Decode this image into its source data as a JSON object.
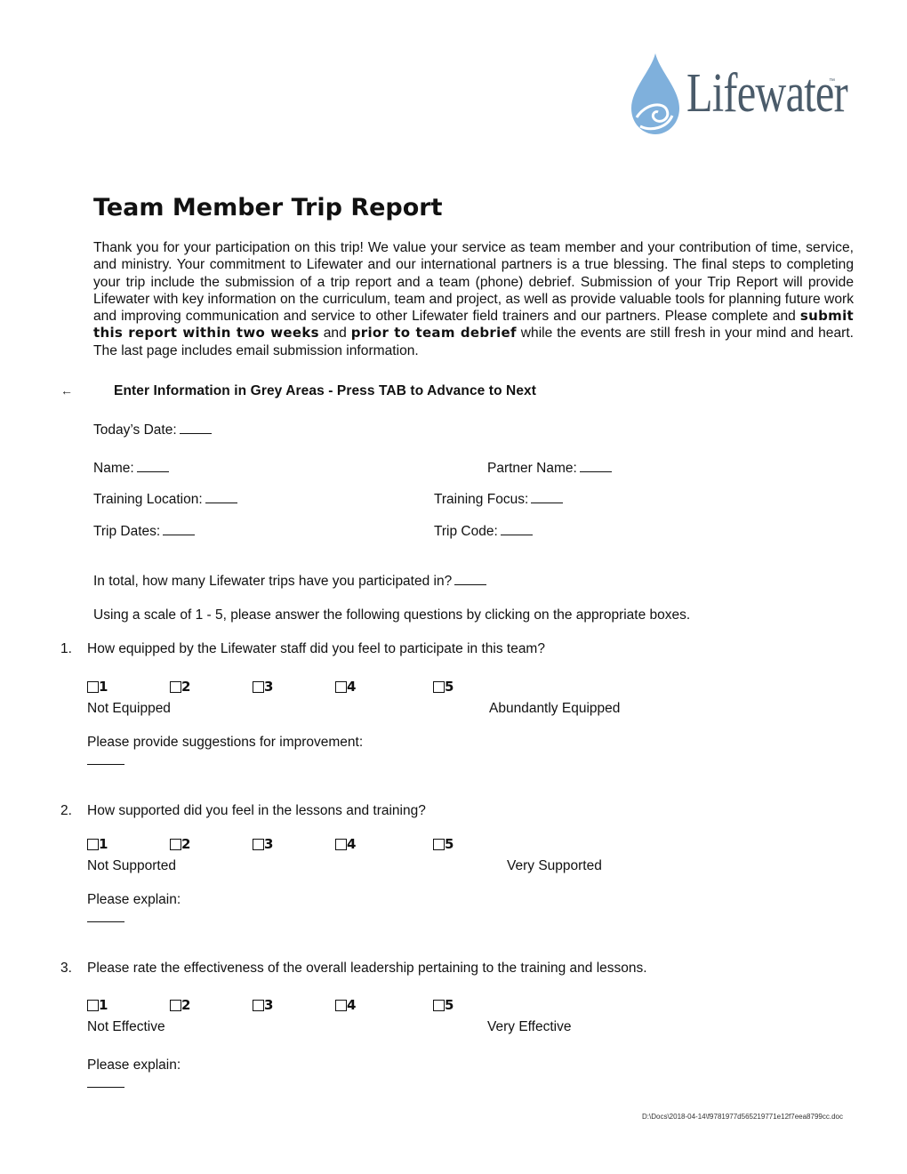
{
  "logo": {
    "brand": "Lifewater",
    "trademark": "™",
    "icon": "water-drop-icon",
    "colors": {
      "drop": "#7fb0dc",
      "text": "#4a5b6a"
    }
  },
  "title": "Team Member Trip Report",
  "intro": {
    "text_before": "Thank you for your participation on this trip! We value your service as team member and your contribution of time, service, and ministry. Your commitment to Lifewater and our international partners is a true blessing. The final steps to completing your trip include the submission of a trip report and a team (phone) debrief. Submission of your Trip Report will provide Lifewater with key information on the curriculum, team and project, as well as provide valuable tools for planning future work and improving communication and service to other Lifewater field trainers and our partners.  Please complete and ",
    "bold_1": "submit this report within two weeks",
    "text_mid": " and ",
    "bold_2": "prior to team debrief",
    "text_after": " while the events are still fresh in your mind and heart. The last page includes email submission information."
  },
  "instruction": {
    "arrow": "←",
    "text": "Enter Information in Grey Areas - Press TAB to Advance to Next"
  },
  "fields": {
    "todays_date": {
      "label": "Today’s Date:",
      "value": ""
    },
    "name": {
      "label": "Name:",
      "value": ""
    },
    "partner_name": {
      "label": "Partner Name:",
      "value": ""
    },
    "training_location": {
      "label": "Training Location:",
      "value": ""
    },
    "training_focus": {
      "label": "Training Focus:",
      "value": ""
    },
    "trip_dates": {
      "label": "Trip Dates:",
      "value": ""
    },
    "trip_code": {
      "label": "Trip Code:",
      "value": ""
    },
    "trips_total": {
      "label": "In total, how many Lifewater trips have you participated in?",
      "value": ""
    }
  },
  "scale_instruction": "Using a scale of 1 - 5, please answer the following questions by clicking on the appropriate boxes.",
  "questions": [
    {
      "number": "1.",
      "text": "How equipped by the Lifewater staff did you feel to participate in this team?",
      "options": [
        "1",
        "2",
        "3",
        "4",
        "5"
      ],
      "low_label": "Not Equipped",
      "high_label": "Abundantly Equipped",
      "followup": "Please provide suggestions for improvement:",
      "answer": ""
    },
    {
      "number": "2.",
      "text": "How supported did you feel in the lessons and training?",
      "options": [
        "1",
        "2",
        "3",
        "4",
        "5"
      ],
      "low_label": "Not Supported",
      "high_label": "Very Supported",
      "followup": "Please explain:",
      "answer": ""
    },
    {
      "number": "3.",
      "text": "Please rate the effectiveness of the overall leadership pertaining to the training and lessons.",
      "options": [
        "1",
        "2",
        "3",
        "4",
        "5"
      ],
      "low_label": "Not Effective",
      "high_label": "Very Effective",
      "followup": "Please explain:",
      "answer": ""
    }
  ],
  "footer": "D:\\Docs\\2018-04-14\\f9781977d565219771e12f7eea8799cc.doc"
}
